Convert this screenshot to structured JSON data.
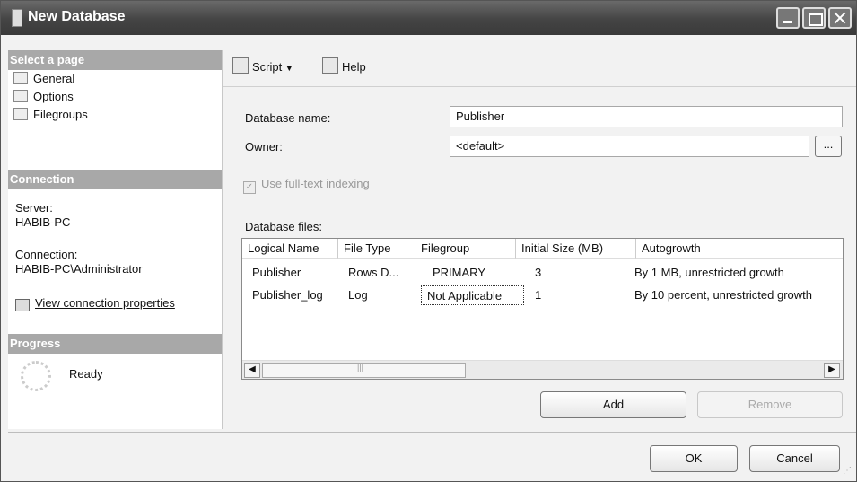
{
  "window": {
    "title": "New Database"
  },
  "left_panel": {
    "select_page_header": "Select a page",
    "pages": [
      "General",
      "Options",
      "Filegroups"
    ],
    "connection_header": "Connection",
    "server_label": "Server:",
    "server_value": "HABIB-PC",
    "connection_label": "Connection:",
    "connection_value": "HABIB-PC\\Administrator",
    "view_connection_link": "View connection properties",
    "progress_header": "Progress",
    "progress_status": "Ready"
  },
  "toolbar": {
    "script_label": "Script",
    "help_label": "Help"
  },
  "form": {
    "database_name_label": "Database name:",
    "database_name_value": "Publisher",
    "owner_label": "Owner:",
    "owner_value": "<default>",
    "browse_label": "...",
    "fulltext_label": "Use full-text indexing",
    "database_files_label": "Database files:"
  },
  "grid": {
    "columns": [
      "Logical Name",
      "File Type",
      "Filegroup",
      "Initial Size (MB)",
      "Autogrowth"
    ],
    "rows": [
      [
        "Publisher",
        "Rows D...",
        "PRIMARY",
        "3",
        "By 1 MB, unrestricted growth"
      ],
      [
        "Publisher_log",
        "Log",
        "Not Applicable",
        "1",
        "By 10 percent, unrestricted growth"
      ]
    ]
  },
  "buttons": {
    "add": "Add",
    "remove": "Remove",
    "ok": "OK",
    "cancel": "Cancel"
  }
}
